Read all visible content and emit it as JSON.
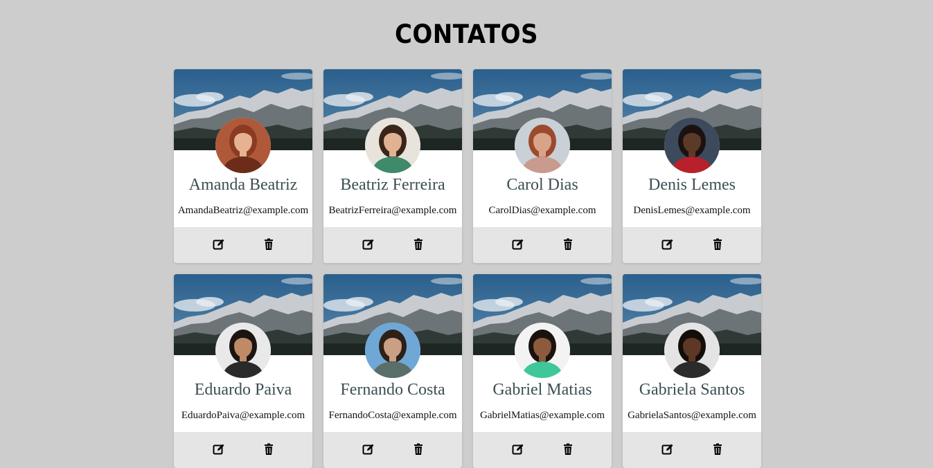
{
  "page": {
    "title": "CONTATOS"
  },
  "colors": {
    "background": "#cdcdcd",
    "card": "#ffffff",
    "actions_bar": "#e5e5e5",
    "name_text": "#3c4e53"
  },
  "contacts": [
    {
      "name": "Amanda Beatriz",
      "email": "AmandaBeatriz@example.com",
      "avatar": "woman-red-hair-photo",
      "skin": "#e7b291",
      "hair": "#8a3b22",
      "bg": "#b0593a",
      "shirt": "#6b2d1a"
    },
    {
      "name": "Beatriz Ferreira",
      "email": "BeatrizFerreira@example.com",
      "avatar": "woman-curly-hair-photo",
      "skin": "#e0b293",
      "hair": "#3a2518",
      "bg": "#e8e4dc",
      "shirt": "#3e8a6b"
    },
    {
      "name": "Carol Dias",
      "email": "CarolDias@example.com",
      "avatar": "woman-on-road-photo",
      "skin": "#d9a38a",
      "hair": "#9b4a2c",
      "bg": "#c9d0d6",
      "shirt": "#c99a8e"
    },
    {
      "name": "Denis Lemes",
      "email": "DenisLemes@example.com",
      "avatar": "man-red-jacket-photo",
      "skin": "#5c3a28",
      "hair": "#1a1210",
      "bg": "#3d4a5c",
      "shirt": "#b8202c"
    },
    {
      "name": "Eduardo Paiva",
      "email": "EduardoPaiva@example.com",
      "avatar": "man-sunglasses-photo",
      "skin": "#c08a66",
      "hair": "#1b1512",
      "bg": "#e9e9e9",
      "shirt": "#2a2a2a"
    },
    {
      "name": "Fernando Costa",
      "email": "FernandoCosta@example.com",
      "avatar": "man-open-arms-landscape-photo",
      "skin": "#c9a083",
      "hair": "#2e2016",
      "bg": "#6fa8d6",
      "shirt": "#5a6e6a"
    },
    {
      "name": "Gabriel Matias",
      "email": "GabrielMatias@example.com",
      "avatar": "man-green-shirt-photo",
      "skin": "#8c5a3c",
      "hair": "#1a120e",
      "bg": "#f3f3f3",
      "shirt": "#3fc79a"
    },
    {
      "name": "Gabriela Santos",
      "email": "GabrielaSantos@example.com",
      "avatar": "woman-glasses-smiling-photo",
      "skin": "#5e3826",
      "hair": "#140e0b",
      "bg": "#e4e4e4",
      "shirt": "#2b2b2b"
    }
  ],
  "icons": {
    "edit": "edit-icon",
    "delete": "trash-icon"
  }
}
